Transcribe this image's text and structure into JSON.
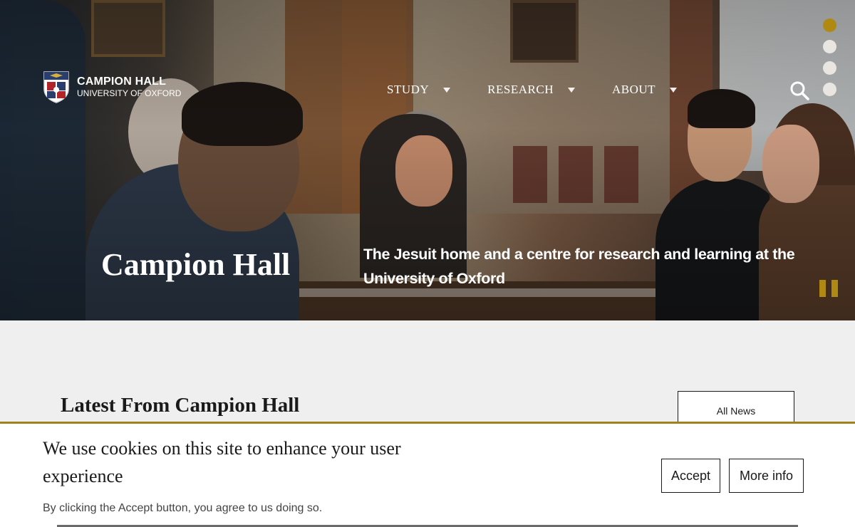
{
  "header": {
    "logo_title": "CAMPION HALL",
    "logo_subtitle": "UNIVERSITY OF OXFORD",
    "nav": [
      {
        "label": "STUDY"
      },
      {
        "label": "RESEARCH"
      },
      {
        "label": "ABOUT"
      }
    ],
    "search_icon": "search-icon"
  },
  "hero": {
    "title": "Campion Hall",
    "caption": "The Jesuit home and a centre for research and learning at the University of Oxford",
    "slides": 4,
    "active_slide": 1,
    "accent_color": "#b08913"
  },
  "main": {
    "section_title": "Latest From Campion Hall",
    "all_news_label": "All News"
  },
  "cookie": {
    "title": "We use cookies on this site to enhance your user experience",
    "subtitle": "By clicking the Accept button, you agree to us doing so.",
    "accept_label": "Accept",
    "more_info_label": "More info",
    "border_color": "#a0821c"
  }
}
